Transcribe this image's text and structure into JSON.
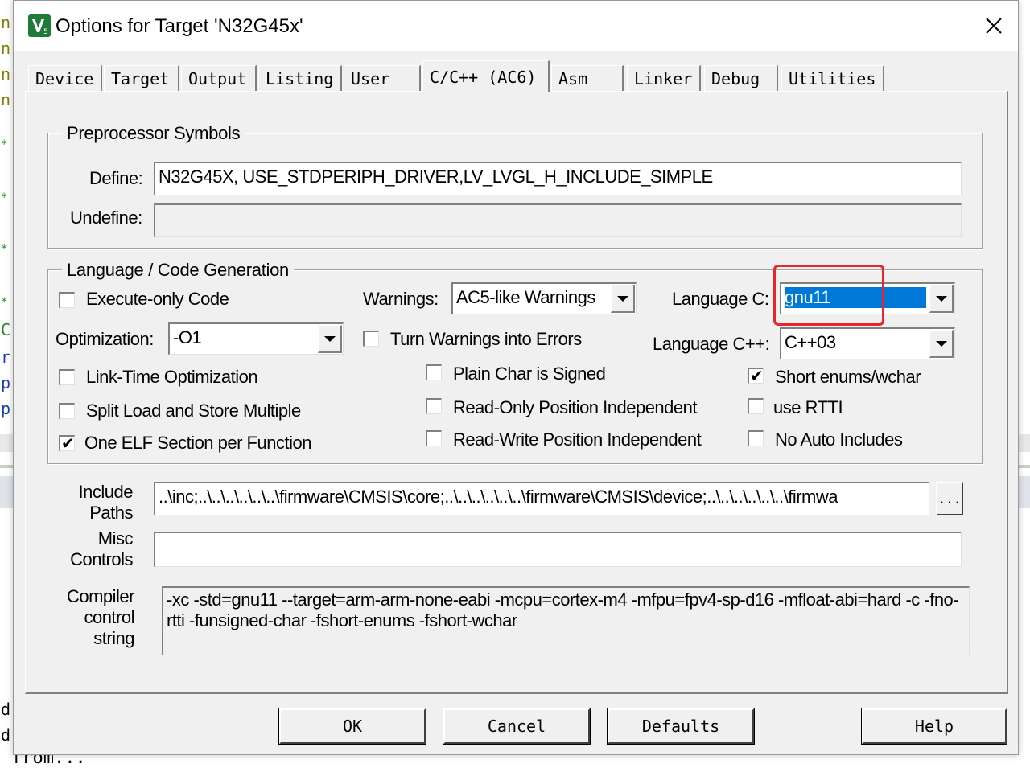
{
  "window": {
    "title": "Options for Target 'N32G45x'"
  },
  "background": {
    "gutter_chars": [
      "n",
      "n",
      "n",
      "n",
      "*",
      "*",
      "*",
      "*",
      "C",
      "r",
      "p",
      "p"
    ],
    "bottom_chars": [
      "d",
      "d"
    ],
    "bottom_text": "from..."
  },
  "tabs": [
    {
      "label": "Device"
    },
    {
      "label": "Target"
    },
    {
      "label": "Output"
    },
    {
      "label": "Listing"
    },
    {
      "label": "User"
    },
    {
      "label": "C/C++ (AC6)"
    },
    {
      "label": "Asm"
    },
    {
      "label": "Linker"
    },
    {
      "label": "Debug"
    },
    {
      "label": "Utilities"
    }
  ],
  "preprocessor": {
    "title": "Preprocessor Symbols",
    "define_label": "Define:",
    "define_value": "N32G45X, USE_STDPERIPH_DRIVER,LV_LVGL_H_INCLUDE_SIMPLE",
    "undefine_label": "Undefine:",
    "undefine_value": ""
  },
  "codegen": {
    "title": "Language / Code Generation",
    "execute_only": {
      "label": "Execute-only Code",
      "checked": false
    },
    "optimization_label": "Optimization:",
    "optimization_value": "-O1",
    "lto": {
      "label": "Link-Time Optimization",
      "checked": false
    },
    "split_load": {
      "label": "Split Load and Store Multiple",
      "checked": false
    },
    "one_elf": {
      "label": "One ELF Section per Function",
      "checked": true
    },
    "warnings_label": "Warnings:",
    "warnings_value": "AC5-like Warnings",
    "warnings_to_errors": {
      "label": "Turn Warnings into Errors",
      "checked": false
    },
    "plain_char": {
      "label": "Plain Char is Signed",
      "checked": false
    },
    "ro_pi": {
      "label": "Read-Only Position Independent",
      "checked": false
    },
    "rw_pi": {
      "label": "Read-Write Position Independent",
      "checked": false
    },
    "language_c_label": "Language C:",
    "language_c_value": "gnu11",
    "language_cpp_label": "Language C++:",
    "language_cpp_value": "C++03",
    "short_enums": {
      "label": "Short enums/wchar",
      "checked": true
    },
    "rtti": {
      "label": "use RTTI",
      "checked": false
    },
    "no_auto_includes": {
      "label": "No Auto Includes",
      "checked": false
    }
  },
  "include_paths": {
    "label_line1": "Include",
    "label_line2": "Paths",
    "value": "..\\inc;..\\..\\..\\..\\..\\..\\firmware\\CMSIS\\core;..\\..\\..\\..\\..\\..\\firmware\\CMSIS\\device;..\\..\\..\\..\\..\\..\\firmwa",
    "browse_label": "..."
  },
  "misc_controls": {
    "label_line1": "Misc",
    "label_line2": "Controls",
    "value": ""
  },
  "compiler_string": {
    "label_line1": "Compiler",
    "label_line2": "control",
    "label_line3": "string",
    "value": "-xc -std=gnu11 --target=arm-arm-none-eabi -mcpu=cortex-m4 -mfpu=fpv4-sp-d16 -mfloat-abi=hard -c -fno-rtti -funsigned-char -fshort-enums -fshort-wchar"
  },
  "buttons": {
    "ok": "OK",
    "cancel": "Cancel",
    "defaults": "Defaults",
    "help": "Help"
  },
  "colors": {
    "highlight": "#0078d7",
    "annotation_red": "#e8262b"
  }
}
